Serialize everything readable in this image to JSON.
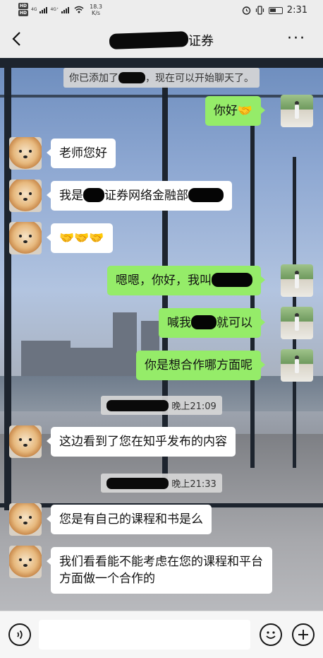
{
  "status": {
    "hd1": "HD",
    "hd2": "HD",
    "sig1": "4G",
    "sig2": "4G⁺",
    "speed": "18.3",
    "speed_unit": "K/s",
    "time": "2:31"
  },
  "nav": {
    "title_suffix": "证券",
    "more": "···"
  },
  "messages": {
    "sys_added_pre": "你已添加了",
    "sys_added_post": "，现在可以开始聊天了。",
    "m1": "你好🤝",
    "m2": "老师您好",
    "m3_pre": "我是",
    "m3_mid": "证券网络金融部",
    "m4": "🤝🤝🤝",
    "m5": "嗯嗯，你好，我叫",
    "m6_pre": "喊我",
    "m6_post": "就可以",
    "m7": "你是想合作哪方面呢",
    "ts1": "晚上21:09",
    "m8": "这边看到了您在知乎发布的内容",
    "ts2": "晚上21:33",
    "m9": "您是有自己的课程和书是么",
    "m10": "我们看看能不能考虑在您的课程和平台方面做一个合作的"
  },
  "colors": {
    "self_bubble": "#95ec69",
    "other_bubble": "#ffffff",
    "bar_bg": "#ededed"
  },
  "icons": {
    "back": "chevron-left-icon",
    "more": "more-dots-icon",
    "voice": "voice-icon",
    "emoji": "emoji-icon",
    "plus": "plus-icon"
  }
}
